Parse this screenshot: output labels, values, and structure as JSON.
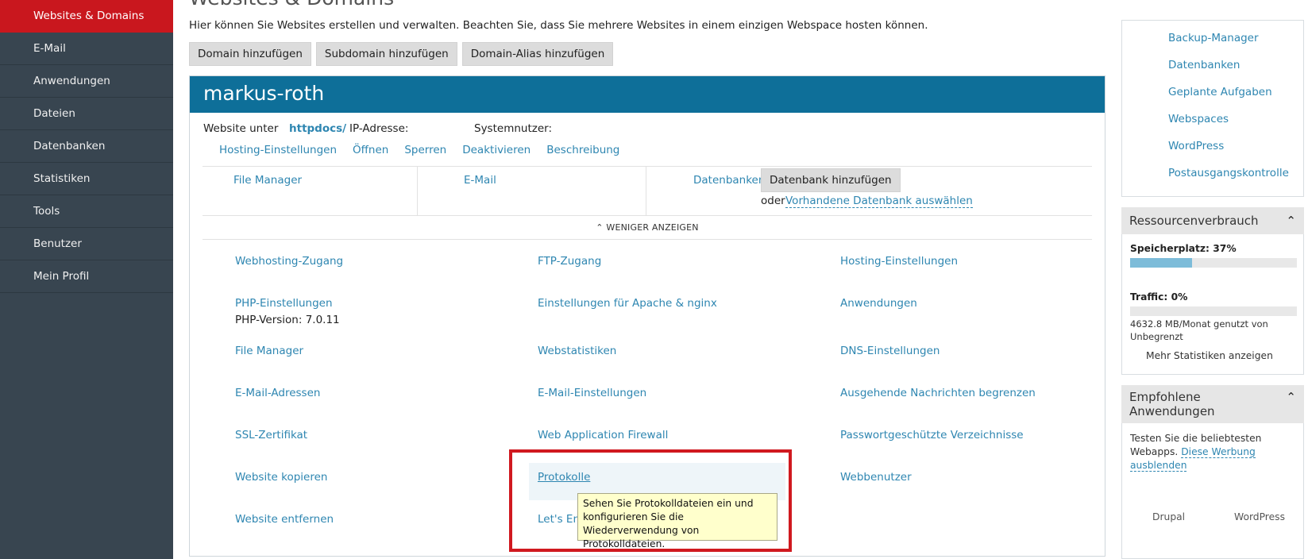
{
  "sidebar": {
    "items": [
      {
        "label": "Websites & Domains",
        "active": true
      },
      {
        "label": "E-Mail"
      },
      {
        "label": "Anwendungen"
      },
      {
        "label": "Dateien"
      },
      {
        "label": "Datenbanken"
      },
      {
        "label": "Statistiken"
      },
      {
        "label": "Tools"
      },
      {
        "label": "Benutzer"
      },
      {
        "label": "Mein Profil"
      }
    ]
  },
  "page": {
    "title": "Websites & Domains",
    "intro": "Hier können Sie Websites erstellen und verwalten. Beachten Sie, dass Sie mehrere Websites in einem einzigen Webspace hosten können.",
    "buttons": [
      "Domain hinzufügen",
      "Subdomain hinzufügen",
      "Domain-Alias hinzufügen"
    ]
  },
  "site": {
    "name": "markus-roth",
    "website_under": "Website unter",
    "docroot": "httpdocs/",
    "ip_label": "IP-Adresse:",
    "sysuser_label": "Systemnutzer:",
    "links": [
      "Hosting-Einstellungen",
      "Öffnen",
      "Sperren",
      "Deaktivieren",
      "Beschreibung"
    ],
    "cols": {
      "file_manager": "File Manager",
      "email": "E-Mail",
      "databases": "Datenbanken",
      "add_db": "Datenbank hinzufügen",
      "or": "oder",
      "select_db": "Vorhandene Datenbank auswählen"
    },
    "show_less": "WENIGER ANZEIGEN",
    "grid": [
      [
        "Webhosting-Zugang",
        "FTP-Zugang",
        "Hosting-Einstellungen"
      ],
      [
        "PHP-Einstellungen",
        "Einstellungen für Apache & nginx",
        "Anwendungen"
      ],
      [
        "File Manager",
        "Webstatistiken",
        "DNS-Einstellungen"
      ],
      [
        "E-Mail-Adressen",
        "E-Mail-Einstellungen",
        "Ausgehende Nachrichten begrenzen"
      ],
      [
        "SSL-Zertifikat",
        "Web Application Firewall",
        "Passwortgeschützte Verzeichnisse"
      ],
      [
        "Website kopieren",
        "Protokolle",
        "Webbenutzer"
      ],
      [
        "Website entfernen",
        "Let's Enc",
        ""
      ]
    ],
    "php_version": "PHP-Version: 7.0.11",
    "tooltip": "Sehen Sie Protokolldateien ein und konfigurieren Sie die Wiederverwendung von Protokolldateien."
  },
  "right": {
    "tools": [
      "Backup-Manager",
      "Datenbanken",
      "Geplante Aufgaben",
      "Webspaces",
      "WordPress",
      "Postausgangskontrolle"
    ],
    "resources": {
      "title": "Ressourcenverbrauch",
      "storage_label": "Speicherplatz: 37%",
      "storage_fraction": 0.37,
      "traffic_label": "Traffic: 0%",
      "traffic_fraction": 0.0,
      "traffic_note": "4632.8 MB/Monat genutzt von Unbegrenzt",
      "more_stats": "Mehr Statistiken anzeigen"
    },
    "recommended": {
      "title": "Empfohlene Anwendungen",
      "text": "Testen Sie die beliebtesten Webapps.",
      "hide_ad": "Diese Werbung ausblenden",
      "apps": [
        "Drupal",
        "WordPress"
      ]
    }
  }
}
